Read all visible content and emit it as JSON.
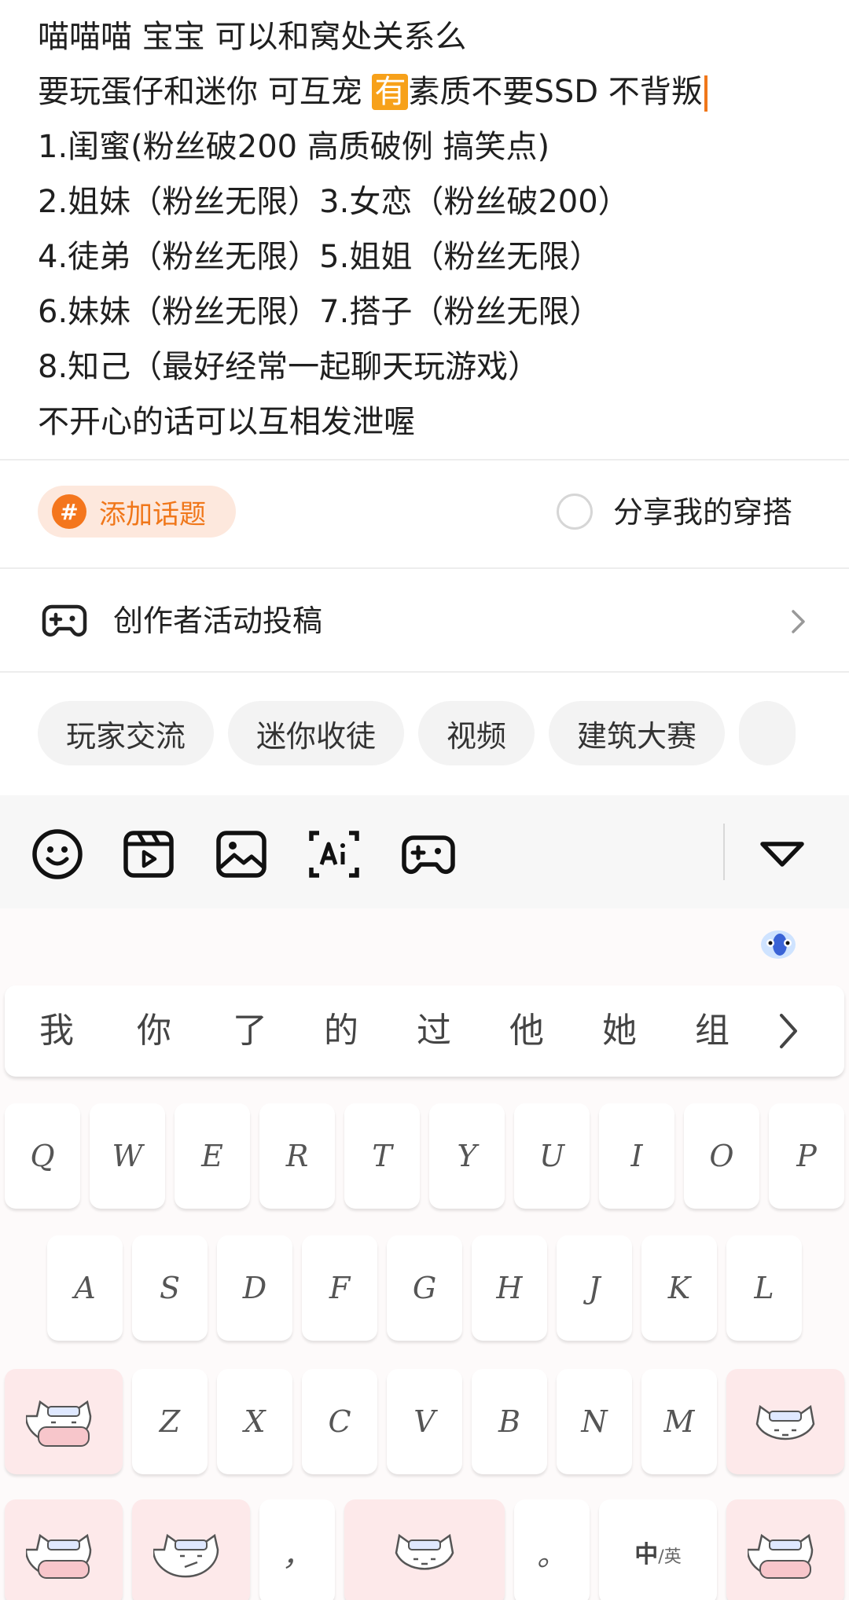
{
  "editor": {
    "lines": [
      "喵喵喵 宝宝 可以和窝处关系么",
      "要玩蛋仔和迷你 可互宠 ",
      "1.闺蜜(粉丝破200 高质破例 搞笑点)",
      "2.姐妹（粉丝无限）3.女恋（粉丝破200）",
      "4.徒弟（粉丝无限）5.姐姐（粉丝无限）",
      "6.妹妹（粉丝无限）7.搭子（粉丝无限）",
      "8.知己（最好经常一起聊天玩游戏）",
      "不开心的话可以互相发泄喔"
    ],
    "line2_highlight": "有",
    "line2_tail": "素质不要SSD  不背叛"
  },
  "topic": {
    "hash_symbol": "#",
    "label": "添加话题"
  },
  "share": {
    "label": "分享我的穿搭"
  },
  "creator": {
    "label": "创作者活动投稿"
  },
  "chips": [
    "玩家交流",
    "迷你收徒",
    "视频",
    "建筑大赛",
    ""
  ],
  "toolbar": {
    "icons": [
      "emoji-icon",
      "video-icon",
      "image-icon",
      "ai-text-icon",
      "gamepad-icon",
      "collapse-icon"
    ]
  },
  "keyboard": {
    "candidates": [
      "我",
      "你",
      "了",
      "的",
      "过",
      "他",
      "她",
      "组"
    ],
    "row1": [
      "Q",
      "W",
      "E",
      "R",
      "T",
      "Y",
      "U",
      "I",
      "O",
      "P"
    ],
    "row2": [
      "A",
      "S",
      "D",
      "F",
      "G",
      "H",
      "J",
      "K",
      "L"
    ],
    "row3": [
      "Z",
      "X",
      "C",
      "V",
      "B",
      "N",
      "M"
    ],
    "comma": "，",
    "period": "。",
    "lang_main": "中",
    "lang_sep": "/英",
    "colors": {
      "accent": "#f0771a",
      "key_pink": "#fde9ea",
      "chip_bg": "#f3f3f3"
    }
  }
}
